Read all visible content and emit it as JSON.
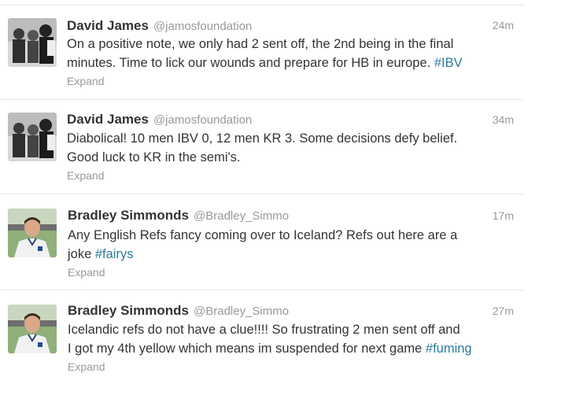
{
  "tweets": [
    {
      "name": "David James",
      "handle": "@jamosfoundation",
      "time": "24m",
      "text": "On a positive note, we only had 2 sent off, the 2nd being in the final\nminutes. Time to lick our wounds and prepare for HB in europe. ",
      "hashtag": "#IBV",
      "expand": "Expand",
      "avatar": "david-james-avatar"
    },
    {
      "name": "David James",
      "handle": "@jamosfoundation",
      "time": "34m",
      "text": "Diabolical! 10 men IBV 0, 12 men KR 3. Some decisions defy belief.\nGood luck to KR in the semi's.",
      "hashtag": "",
      "expand": "Expand",
      "avatar": "david-james-avatar"
    },
    {
      "name": "Bradley Simmonds",
      "handle": "@Bradley_Simmo",
      "time": "17m",
      "text": "Any English Refs fancy coming over to Iceland? Refs out here are a\njoke ",
      "hashtag": "#fairys",
      "expand": "Expand",
      "avatar": "bradley-simmonds-avatar"
    },
    {
      "name": "Bradley Simmonds",
      "handle": "@Bradley_Simmo",
      "time": "27m",
      "text": "Icelandic refs do not have a clue!!!! So frustrating 2 men sent off and\nI got my 4th yellow which means im suspended for next game ",
      "hashtag": "#fuming",
      "expand": "Expand",
      "avatar": "bradley-simmonds-avatar"
    }
  ],
  "colors": {
    "hashtag": "#2a7a9b",
    "muted": "#999999",
    "divider": "#e1e8ed"
  }
}
